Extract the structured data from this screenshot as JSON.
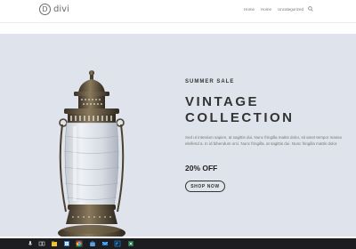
{
  "header": {
    "logo_letter": "D",
    "logo_text": "divi",
    "nav": [
      "Home",
      "Home",
      "Uncategorized"
    ],
    "search_icon": "search-icon"
  },
  "hero": {
    "eyebrow": "SUMMER SALE",
    "headline": "VINTAGE COLLECTION",
    "body": "Sed ut interdum sapien, at sagittis dui. Nunc fringilla mattis dolor, sit amet tempor massa eleifend a. In id bibendum orci. Nunc fringilla, at sagittis dui. Nunc fringilla mattis dolor.",
    "discount": "20% OFF",
    "cta_label": "SHOP NOW",
    "background_color": "#dfe3eb",
    "image": "vintage-lantern"
  },
  "taskbar": {
    "icons": [
      "microphone-icon",
      "task-view-icon",
      "file-explorer-icon",
      "windows-store-icon",
      "chrome-icon",
      "store-bag-icon",
      "photoshop-icon",
      "terminal-icon",
      "excel-icon"
    ]
  }
}
